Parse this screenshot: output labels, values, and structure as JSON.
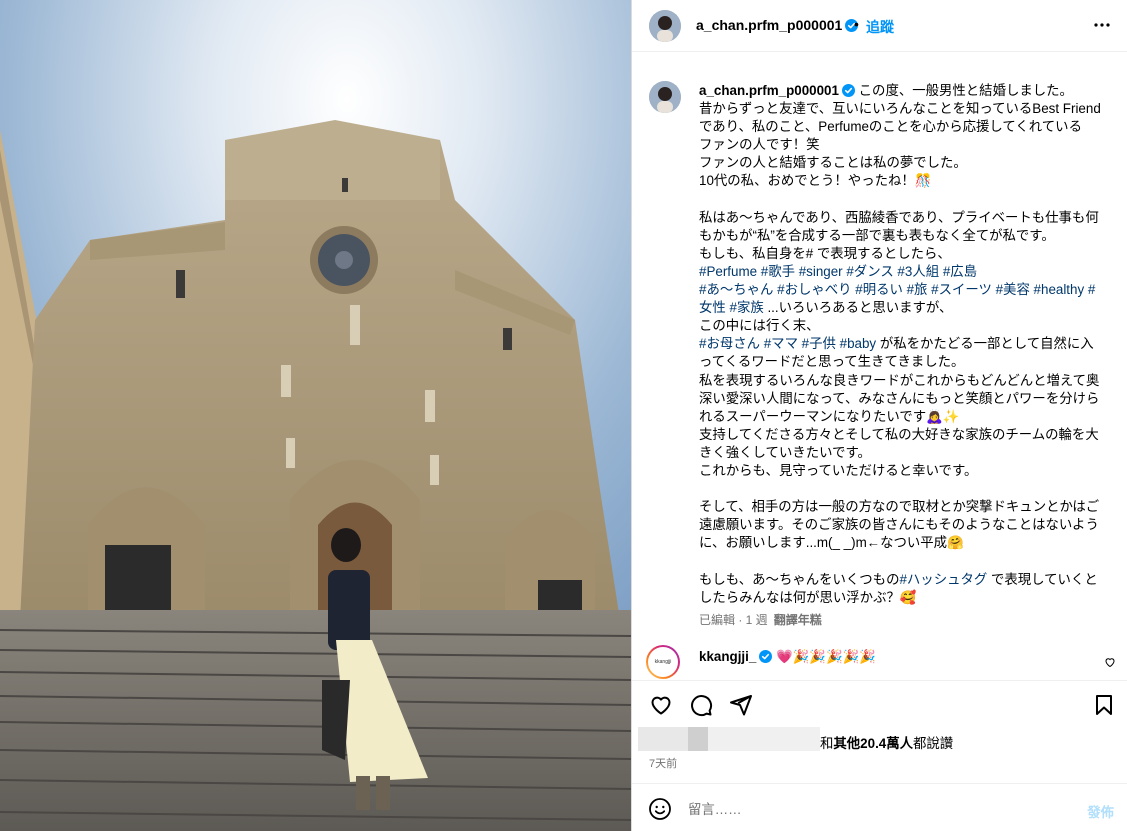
{
  "header": {
    "username": "a_chan.prfm_p000001",
    "separator": "•",
    "follow_label": "追蹤",
    "more_icon": "more-horizontal-icon"
  },
  "caption": {
    "username": "a_chan.prfm_p000001",
    "lines": [
      "この度、一般男性と結婚しました。",
      "昔からずっと友達で、互いにいろんなことを知っているBest Friend",
      "であり、私のこと、Perfumeのことを心から応援してくれている",
      "ファンの人です！笑",
      "ファンの人と結婚することは私の夢でした。",
      "10代の私、おめでとう！やったね！🎊",
      "",
      "私はあ〜ちゃんであり、西脇綾香であり、プライベートも仕事も何",
      "もかもが“私”を合成する一部で裏も表もなく全てが私です。",
      "もしも、私自身を# で表現するとしたら、"
    ],
    "tags_line1": "#Perfume #歌手 #singer #ダンス #3人組 #広島",
    "tags_line2": "#あ〜ちゃん #おしゃべり #明るい #旅 #スイーツ #美容 #healthy #",
    "tags_line3_tags": "女性 #家族",
    "tags_line3_text": " ...いろいろあると思いますが、",
    "line_after_tags": "この中には行く末、",
    "tags_line4": "#お母さん #ママ #子供 #baby",
    "tags_line4_text": " が私をかたどる一部として自然に入",
    "lines_after": [
      "ってくるワードだと思って生きてきました。",
      "私を表現するいろんな良きワードがこれからもどんどんと増えて奥",
      "深い愛深い人間になって、みなさんにもっと笑顔とパワーを分けら",
      "れるスーパーウーマンになりたいです🙇‍♀️✨",
      "支持してくださる方々とそして私の大好きな家族のチームの輪を大",
      "きく強くしていきたいです。",
      "これからも、見守っていただけると幸いです。",
      "",
      "そして、相手の方は一般の方なので取材とか突撃ドキュンとかはご",
      "遠慮願います。そのご家族の皆さんにもそのようなことはないよう",
      "に、お願いします...m(_ _)m←なつい平成🤗",
      ""
    ],
    "final_prefix": "もしも、あ〜ちゃんをいくつもの",
    "final_tag": "#ハッシュタグ",
    "final_suffix": " で表現していくと",
    "final_line2": "したらみんなは何が思い浮かぶ？🥰"
  },
  "meta": {
    "edited": "已編輯 · 1 週",
    "translate": "翻譯年糕"
  },
  "comment": {
    "username": "kkangjji_",
    "text": " 💗🎉🎉🎉🎉🎉",
    "avatar_text": "kkangjji"
  },
  "likes": {
    "suffix": "和",
    "bold": "其他20.4萬人",
    "end": "都說讚"
  },
  "date": "7天前",
  "add_comment": {
    "placeholder": "留言……",
    "post_label": "發佈"
  },
  "colors": {
    "link": "#0095f6",
    "hashtag": "#00376b",
    "muted": "#737373"
  }
}
